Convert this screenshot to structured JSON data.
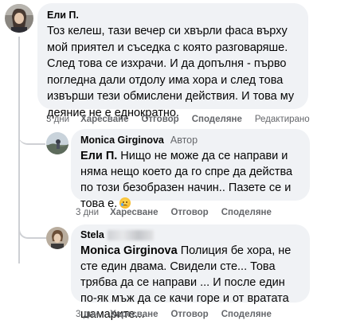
{
  "comments": [
    {
      "author": "Ели П.",
      "text": "Тоз келеш, тази вечер си хвърли фаса върху мой приятел и съседка с която разговаряше. След това се изхрачи. И да допълня - първо погледна дали отдолу има хора и след това извърши тези обмислени действия. И това му деяние не е еднократно.",
      "actions": {
        "time": "3 дни",
        "like": "Харесване",
        "reply": "Отговор",
        "share": "Споделяне",
        "edited": "Редактирано"
      }
    },
    {
      "author": "Monica Girginova",
      "badge": "Автор",
      "mention": "Ели П.",
      "text": " Нищо не може да се направи и няма нещо което да го спре да действа по този безобразен начин.. Пазете се и това е.",
      "emoji": "sad-tear-emoji",
      "actions": {
        "time": "3 дни",
        "like": "Харесване",
        "reply": "Отговор",
        "share": "Споделяне"
      }
    },
    {
      "author": "Stela",
      "mention": "Monica Girginova",
      "text": " Полиция бе хора, не сте един двама. Свидели сте... Това трябва да се направи ... И после един по-як мъж да се качи горе и от вратата шамарите...",
      "actions": {
        "time": "3 дни",
        "like": "Харесване",
        "reply": "Отговор",
        "share": "Споделяне"
      }
    }
  ],
  "colors": {
    "bubble": "#f0f2f5",
    "meta": "#65676b",
    "text": "#050505",
    "thread": "#ced0d4"
  }
}
